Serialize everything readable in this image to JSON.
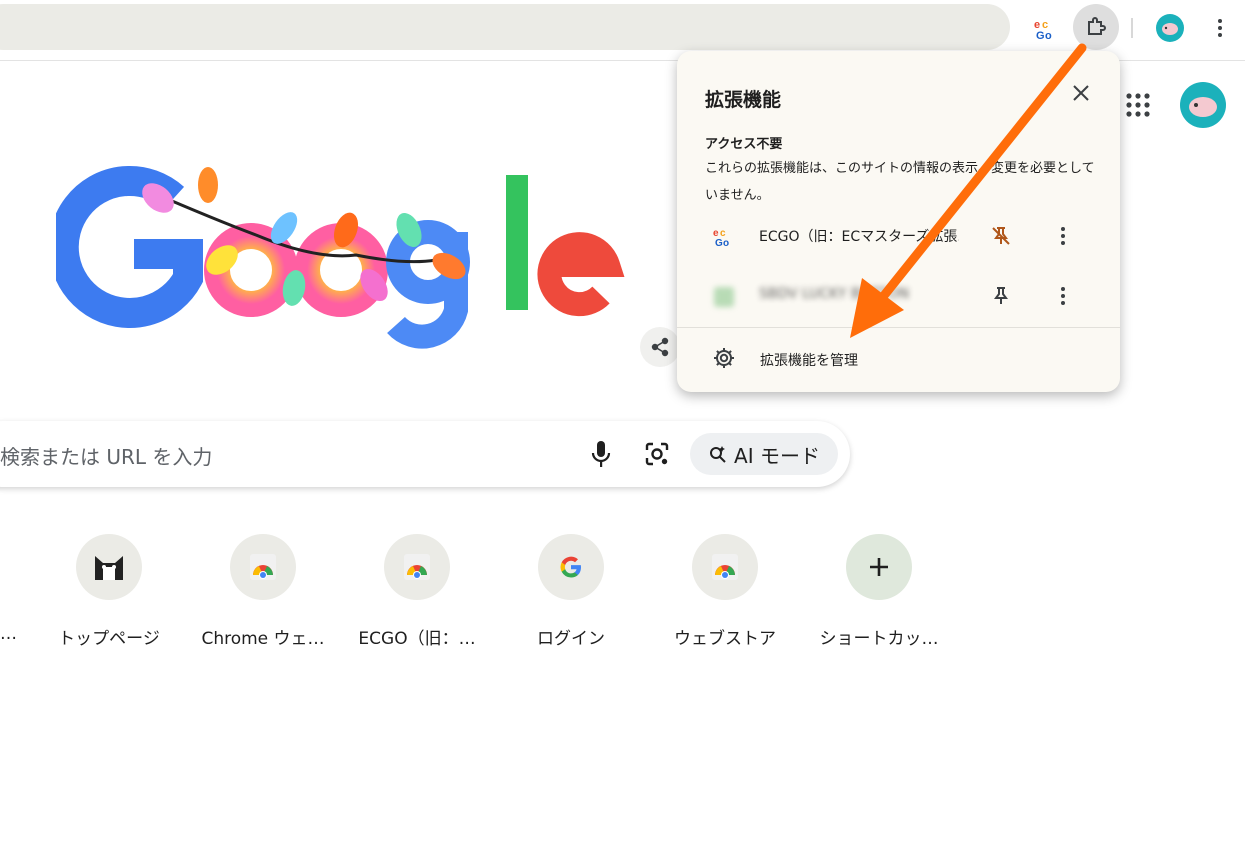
{
  "toolbar": {
    "extension_icon": "ecgo-extension-icon",
    "puzzle_icon": "extensions-puzzle-icon",
    "menu_icon": "three-dot-menu-icon"
  },
  "search": {
    "placeholder": "検索または URL を入力",
    "ai_mode_label": "AI モード"
  },
  "shortcuts": [
    {
      "label": "トップページ",
      "icon": "cat-icon"
    },
    {
      "label": "Chrome ウェ…",
      "icon": "chrome-icon"
    },
    {
      "label": "ECGO（旧：…",
      "icon": "chrome-icon"
    },
    {
      "label": "ログイン",
      "icon": "google-g-icon"
    },
    {
      "label": "ウェブストア",
      "icon": "chrome-icon"
    },
    {
      "label": "ショートカッ…",
      "icon": "plus-icon"
    }
  ],
  "partial_shortcut_label": "…",
  "popup": {
    "title": "拡張機能",
    "section_title": "アクセス不要",
    "description": "これらの拡張機能は、このサイトの情報の表示、変更を必要としていません。",
    "extensions": [
      {
        "name": "ECGO（旧：ECマスターズ拡張...",
        "pinned": true
      },
      {
        "name": "SBDV LUCKY BUTTON",
        "pinned": false
      }
    ],
    "manage_label": "拡張機能を管理"
  },
  "colors": {
    "annotation_arrow": "#ff6d0a",
    "popup_bg": "#fbf9f3",
    "omnibox_bg": "#ebebe6"
  }
}
